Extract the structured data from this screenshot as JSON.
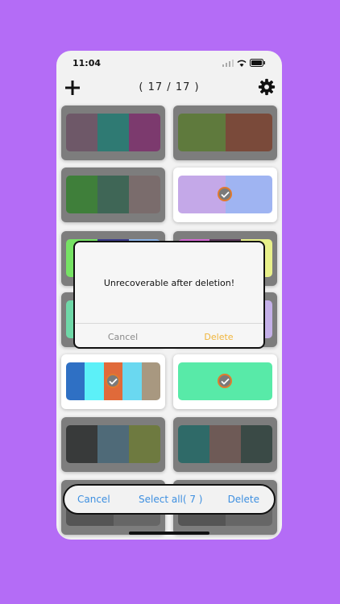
{
  "status": {
    "time": "11:04"
  },
  "header": {
    "counter": "( 17 / 17 )"
  },
  "palettes": [
    {
      "selected": false,
      "colors": [
        "#6e5868",
        "#2f7a73",
        "#7c3a6e"
      ]
    },
    {
      "selected": false,
      "colors": [
        "#5f7a3d",
        "#7a4a3a"
      ]
    },
    {
      "selected": false,
      "colors": [
        "#3f7f3a",
        "#3f6656",
        "#7a6c6c"
      ]
    },
    {
      "selected": true,
      "colors": [
        "#c4a8e8",
        "#9fb4f2"
      ]
    },
    {
      "selected": false,
      "colors": [
        "#76e264",
        "#3a3a8a",
        "#8ab3e8"
      ]
    },
    {
      "selected": false,
      "colors": [
        "#d468d4",
        "#5a3a5a",
        "#e8f08a"
      ]
    },
    {
      "selected": false,
      "colors": [
        "#6fd8a8",
        "#5ab4b4"
      ]
    },
    {
      "selected": false,
      "colors": [
        "#a8c0e8",
        "#c4b0e8"
      ]
    },
    {
      "selected": true,
      "colors": [
        "#2f70c4",
        "#5cf0f8",
        "#e06a3a",
        "#6ad8f0",
        "#a89880"
      ]
    },
    {
      "selected": true,
      "colors": [
        "#58eaa8"
      ]
    },
    {
      "selected": false,
      "colors": [
        "#383a3a",
        "#4f6a78",
        "#6e7a40"
      ]
    },
    {
      "selected": false,
      "colors": [
        "#2f6a68",
        "#6e5a56",
        "#3a4a46"
      ]
    },
    {
      "selected": false,
      "colors": [
        "#555555",
        "#666666"
      ]
    },
    {
      "selected": false,
      "colors": [
        "#555555",
        "#666666"
      ]
    }
  ],
  "dialog": {
    "message": "Unrecoverable after deletion!",
    "cancel": "Cancel",
    "delete": "Delete"
  },
  "bottom_bar": {
    "cancel": "Cancel",
    "select_all": "Select all( 7 )",
    "delete": "Delete"
  },
  "colors": {
    "background": "#b46cf6",
    "accent": "#3d8fe0",
    "dialog_delete": "#f0b53a"
  }
}
